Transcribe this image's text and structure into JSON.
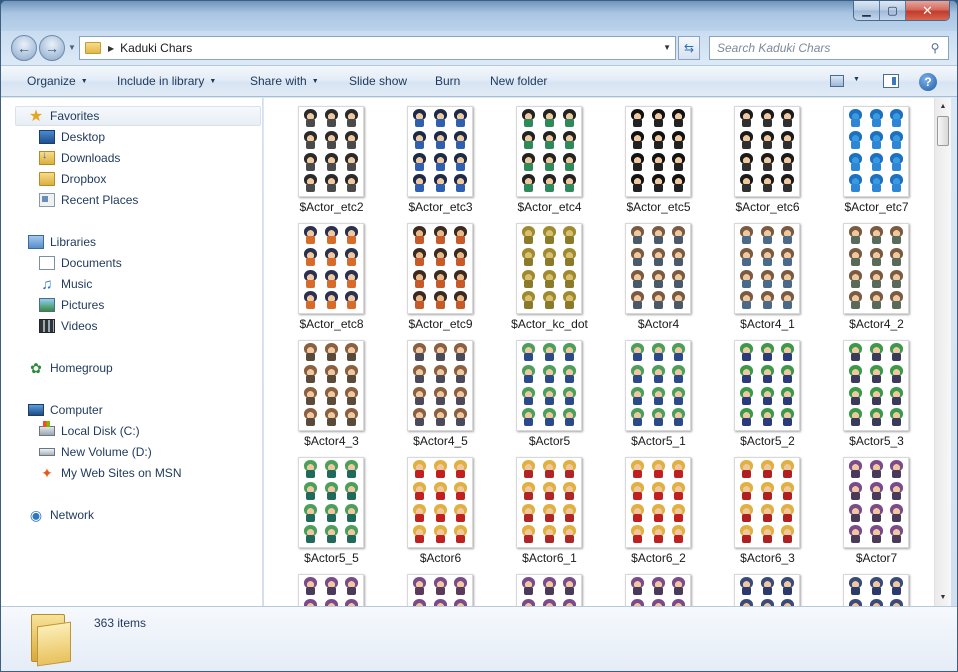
{
  "window": {
    "caption_buttons": {
      "minimize": "▁",
      "maximize": "▢",
      "close": "✕"
    }
  },
  "navigation": {
    "address_path": "Kaduki Chars",
    "search_placeholder": "Search Kaduki Chars"
  },
  "toolbar": {
    "organize": "Organize",
    "include_in_library": "Include in library",
    "share_with": "Share with",
    "slide_show": "Slide show",
    "burn": "Burn",
    "new_folder": "New folder"
  },
  "sidebar": {
    "favorites": {
      "label": "Favorites",
      "icon": "star-icon"
    },
    "favorites_items": [
      {
        "label": "Desktop",
        "icon": "desktop-icon"
      },
      {
        "label": "Downloads",
        "icon": "downloads-folder-icon"
      },
      {
        "label": "Dropbox",
        "icon": "folder-icon"
      },
      {
        "label": "Recent Places",
        "icon": "recent-places-icon"
      }
    ],
    "libraries": {
      "label": "Libraries",
      "icon": "libraries-icon"
    },
    "libraries_items": [
      {
        "label": "Documents",
        "icon": "documents-icon"
      },
      {
        "label": "Music",
        "icon": "music-icon"
      },
      {
        "label": "Pictures",
        "icon": "pictures-icon"
      },
      {
        "label": "Videos",
        "icon": "videos-icon"
      }
    ],
    "homegroup": {
      "label": "Homegroup",
      "icon": "homegroup-icon"
    },
    "computer": {
      "label": "Computer",
      "icon": "computer-icon"
    },
    "computer_items": [
      {
        "label": "Local Disk (C:)",
        "icon": "local-disk-icon"
      },
      {
        "label": "New Volume (D:)",
        "icon": "drive-icon"
      },
      {
        "label": "My Web Sites on MSN",
        "icon": "msn-icon"
      }
    ],
    "network": {
      "label": "Network",
      "icon": "network-icon"
    }
  },
  "files": [
    {
      "name": "$Actor_etc2",
      "skin": "#f0c8a0",
      "hair": "#2a2a2a",
      "cloth": "#4a4a4a"
    },
    {
      "name": "$Actor_etc3",
      "skin": "#f0c8a0",
      "hair": "#1c2a4a",
      "cloth": "#2f5fb0"
    },
    {
      "name": "$Actor_etc4",
      "skin": "#f0c8a0",
      "hair": "#222222",
      "cloth": "#2e8a5a"
    },
    {
      "name": "$Actor_etc5",
      "skin": "#f0c8a0",
      "hair": "#111111",
      "cloth": "#222222"
    },
    {
      "name": "$Actor_etc6",
      "skin": "#f0c8a0",
      "hair": "#1a1a1a",
      "cloth": "#303030"
    },
    {
      "name": "$Actor_etc7",
      "skin": "#3a9ae0",
      "hair": "#1d6fc0",
      "cloth": "#2d86d6"
    },
    {
      "name": "$Actor_etc8",
      "skin": "#f0c8a0",
      "hair": "#2a3050",
      "cloth": "#d86a2a"
    },
    {
      "name": "$Actor_etc9",
      "skin": "#e8b888",
      "hair": "#3a2a20",
      "cloth": "#c85a2a"
    },
    {
      "name": "$Actor_kc_dot",
      "skin": "#d8c070",
      "hair": "#a08a30",
      "cloth": "#8a7a2a"
    },
    {
      "name": "$Actor4",
      "skin": "#f0c8a0",
      "hair": "#7a5a40",
      "cloth": "#4a5a6a"
    },
    {
      "name": "$Actor4_1",
      "skin": "#f0c8a0",
      "hair": "#7a5a40",
      "cloth": "#4a6a8a"
    },
    {
      "name": "$Actor4_2",
      "skin": "#f0c8a0",
      "hair": "#7a5a40",
      "cloth": "#5a6a5a"
    },
    {
      "name": "$Actor4_3",
      "skin": "#f0c8a0",
      "hair": "#8a6040",
      "cloth": "#5a4a3a"
    },
    {
      "name": "$Actor4_5",
      "skin": "#f0c8a0",
      "hair": "#8a6040",
      "cloth": "#4a4a5a"
    },
    {
      "name": "$Actor5",
      "skin": "#f0c8a0",
      "hair": "#4aa05a",
      "cloth": "#2a4a8a"
    },
    {
      "name": "$Actor5_1",
      "skin": "#f0c8a0",
      "hair": "#4aa05a",
      "cloth": "#2a4a8a"
    },
    {
      "name": "$Actor5_2",
      "skin": "#f0c8a0",
      "hair": "#3a9a4a",
      "cloth": "#2a3a7a"
    },
    {
      "name": "$Actor5_3",
      "skin": "#f0c8a0",
      "hair": "#3a9a4a",
      "cloth": "#3a3a5a"
    },
    {
      "name": "$Actor5_5",
      "skin": "#f0c8a0",
      "hair": "#4aa05a",
      "cloth": "#1f6a5a"
    },
    {
      "name": "$Actor6",
      "skin": "#f0c8a0",
      "hair": "#e0b040",
      "cloth": "#c02020"
    },
    {
      "name": "$Actor6_1",
      "skin": "#f0c8a0",
      "hair": "#e0b040",
      "cloth": "#b02525"
    },
    {
      "name": "$Actor6_2",
      "skin": "#f0c8a0",
      "hair": "#e0b040",
      "cloth": "#c02020"
    },
    {
      "name": "$Actor6_3",
      "skin": "#f0c8a0",
      "hair": "#e0b040",
      "cloth": "#b02020"
    },
    {
      "name": "$Actor7",
      "skin": "#f0c8a0",
      "hair": "#7a4a8a",
      "cloth": "#4a3a5a"
    },
    {
      "name": "",
      "skin": "#f0c8a0",
      "hair": "#7a4a8a",
      "cloth": "#4a3a5a"
    },
    {
      "name": "",
      "skin": "#f0c8a0",
      "hair": "#7a4a8a",
      "cloth": "#5a3a5a"
    },
    {
      "name": "",
      "skin": "#f0c8a0",
      "hair": "#7a4a8a",
      "cloth": "#4a3a5a"
    },
    {
      "name": "",
      "skin": "#f0c8a0",
      "hair": "#7a4a8a",
      "cloth": "#4a3a5a"
    },
    {
      "name": "",
      "skin": "#f0c8a0",
      "hair": "#3a4a7a",
      "cloth": "#2a3a6a"
    },
    {
      "name": "",
      "skin": "#f0c8a0",
      "hair": "#3a4a7a",
      "cloth": "#2a3a6a"
    }
  ],
  "details": {
    "item_count": "363 items"
  }
}
